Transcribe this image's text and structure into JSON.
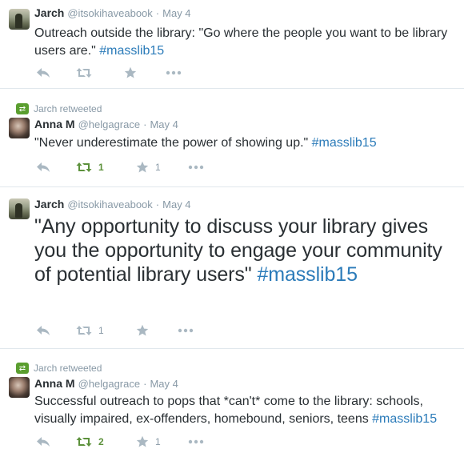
{
  "tweets": [
    {
      "retweeted_by": null,
      "name": "Jarch",
      "handle": "@itsokihaveabook",
      "time": "May 4",
      "text_pre": "Outreach outside the library: \"Go where the people you want to be library users are.\" ",
      "hashtag": "#masslib15",
      "retweets": "",
      "favorites": ""
    },
    {
      "retweeted_by": "Jarch retweeted",
      "name": "Anna M",
      "handle": "@helgagrace",
      "time": "May 4",
      "text_pre": "\"Never underestimate the power of showing up.\" ",
      "hashtag": "#masslib15",
      "retweets": "1",
      "favorites": "1"
    },
    {
      "retweeted_by": null,
      "name": "Jarch",
      "handle": "@itsokihaveabook",
      "time": "May 4",
      "text_pre": "\"Any opportunity to discuss your library gives you the opportunity to engage your community of potential library users\" ",
      "hashtag": "#masslib15",
      "retweets": "1",
      "favorites": ""
    },
    {
      "retweeted_by": "Jarch retweeted",
      "name": "Anna M",
      "handle": "@helgagrace",
      "time": "May 4",
      "text_pre": "Successful outreach to pops that *can't* come to the library: schools, visually impaired, ex-offenders, homebound, seniors, teens ",
      "hashtag": "#masslib15",
      "retweets": "2",
      "favorites": "1"
    }
  ],
  "time_separator": "·",
  "icons": {
    "reply": "reply-arrow-icon",
    "retweet": "retweet-icon",
    "favorite": "star-icon",
    "more": "ellipsis-icon",
    "retweeted_badge": "retweet-badge-icon"
  },
  "colors": {
    "text": "#292f33",
    "muted": "#8899a6",
    "hashtag": "#2b7bb9",
    "retweet_active": "#5c913b"
  }
}
